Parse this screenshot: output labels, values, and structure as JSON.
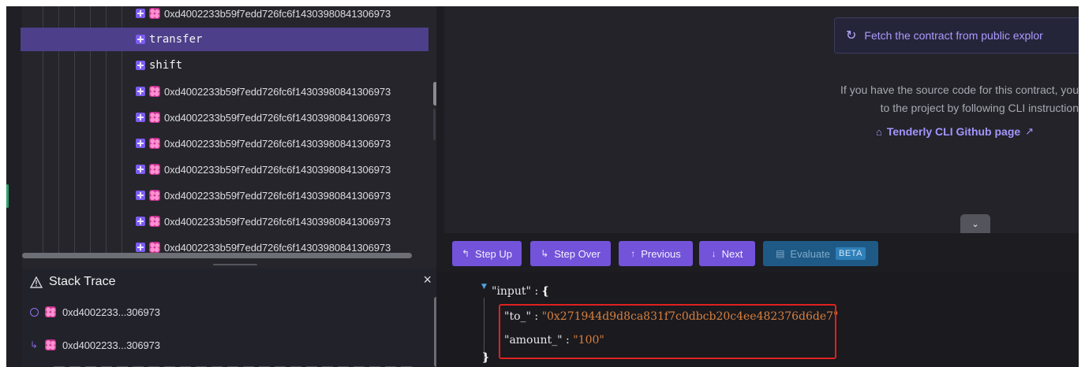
{
  "call_tree": {
    "rows": [
      {
        "type": "contract",
        "label": "0xd4002233b59f7edd726fc6f14303980841306973",
        "selected": false
      },
      {
        "type": "function",
        "label": "transfer",
        "selected": true
      },
      {
        "type": "function",
        "label": "shift",
        "selected": false
      },
      {
        "type": "contract",
        "label": "0xd4002233b59f7edd726fc6f14303980841306973",
        "selected": false
      },
      {
        "type": "contract",
        "label": "0xd4002233b59f7edd726fc6f14303980841306973",
        "selected": false
      },
      {
        "type": "contract",
        "label": "0xd4002233b59f7edd726fc6f14303980841306973",
        "selected": false
      },
      {
        "type": "contract",
        "label": "0xd4002233b59f7edd726fc6f14303980841306973",
        "selected": false
      },
      {
        "type": "contract",
        "label": "0xd4002233b59f7edd726fc6f14303980841306973",
        "selected": false
      },
      {
        "type": "contract",
        "label": "0xd4002233b59f7edd726fc6f14303980841306973",
        "selected": false
      },
      {
        "type": "contract",
        "label": "0xd4002233b59f7edd726fc6f14303980841306973",
        "selected": false
      }
    ]
  },
  "stack_trace": {
    "title": "Stack Trace",
    "close": "×",
    "items": [
      {
        "marker": "ring",
        "label": "0xd4002233...306973"
      },
      {
        "marker": "hook",
        "label": "0xd4002233...306973"
      }
    ]
  },
  "source_panel": {
    "fetch_button": "Fetch the contract from public explor",
    "info_line1": "If you have the source code for this contract, you",
    "info_line2": "to the project by following CLI instruction",
    "cli_link": "Tenderly CLI Github page"
  },
  "toolbar": {
    "step_up": "Step Up",
    "step_over": "Step Over",
    "previous": "Previous",
    "next": "Next",
    "evaluate": "Evaluate",
    "beta": "BETA"
  },
  "code": {
    "input_key": "\"input\"",
    "colon": ":",
    "open_brace": "{",
    "close_brace": "}",
    "to_key": "\"to_\"",
    "to_value": "\"0x271944d9d8ca831f7c0dbcb20c4ee482376d6de7\"",
    "amount_key": "\"amount_\"",
    "amount_value": "\"100\""
  },
  "colors": {
    "accent": "#7253d9",
    "selected_row": "#4d3f8a",
    "highlight_box": "#e0211f",
    "string_value": "#d9803e"
  }
}
